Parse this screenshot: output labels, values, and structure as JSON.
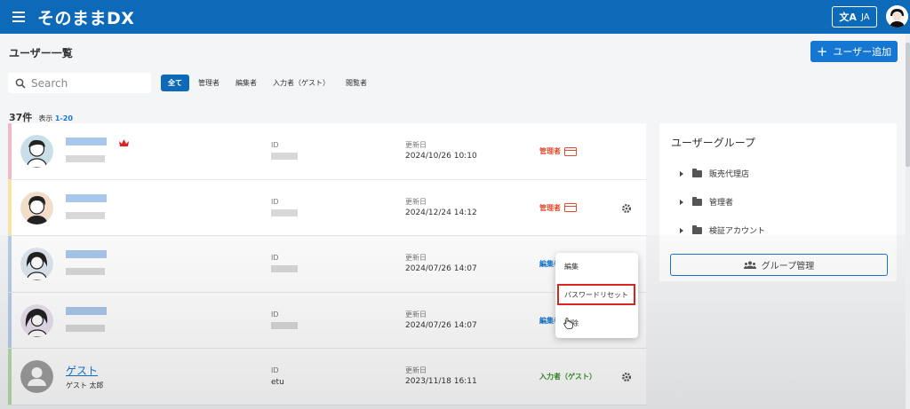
{
  "app": {
    "title": "そのままDX"
  },
  "header": {
    "lang_label": "JA",
    "lang_glyph": "文A"
  },
  "page": {
    "title": "ユーザー一覧",
    "add_user_label": "ユーザー追加"
  },
  "search": {
    "placeholder": "Search"
  },
  "filters": [
    "全て",
    "管理者",
    "編集者",
    "入力者（ゲスト）",
    "閲覧者"
  ],
  "summary": {
    "count": "37件",
    "range_prefix": "表示",
    "range": "1-20"
  },
  "columns": {
    "id": "ID",
    "updated": "更新日"
  },
  "users": [
    {
      "name": "",
      "sub": "",
      "id": "",
      "updated": "2024/10/26 10:10",
      "role": "管理者",
      "role_color": "#e34b2c",
      "stripe": "#f2b8c6"
    },
    {
      "name": "",
      "sub": "",
      "id": "",
      "updated": "2024/12/24 14:12",
      "role": "管理者",
      "role_color": "#e34b2c",
      "stripe": "#f7e3a6"
    },
    {
      "name": "",
      "sub": "",
      "id": "",
      "updated": "2024/07/26 14:07",
      "role": "編集者",
      "role_color": "#1677d2",
      "stripe": "#b9cde8"
    },
    {
      "name": "",
      "sub": "",
      "id": "",
      "updated": "2024/07/26 14:07",
      "role": "編集者",
      "role_color": "#1677d2",
      "stripe": "#b9cde8"
    },
    {
      "name": "ゲスト",
      "sub": "ゲスト 太郎",
      "id": "etu",
      "updated": "2023/11/18 16:11",
      "role": "入力者（ゲスト）",
      "role_color": "#3a8a2e",
      "stripe": "#b7dcae"
    }
  ],
  "context_menu": {
    "items": [
      "編集",
      "パスワードリセット",
      "削除"
    ],
    "highlighted": "パスワードリセット"
  },
  "group_panel": {
    "title": "ユーザーグループ",
    "groups": [
      "販売代理店",
      "管理者",
      "検証アカウント"
    ],
    "manage_label": "グループ管理"
  },
  "colors": {
    "brand": "#0d6ab8",
    "accent": "#1677d2",
    "highlight_border": "#d9261c"
  },
  "icons": {
    "menu": "hamburger-icon",
    "search": "search-icon",
    "crown": "crown-icon",
    "gear": "gear-icon",
    "folder": "folder-icon",
    "group": "group-icon"
  }
}
